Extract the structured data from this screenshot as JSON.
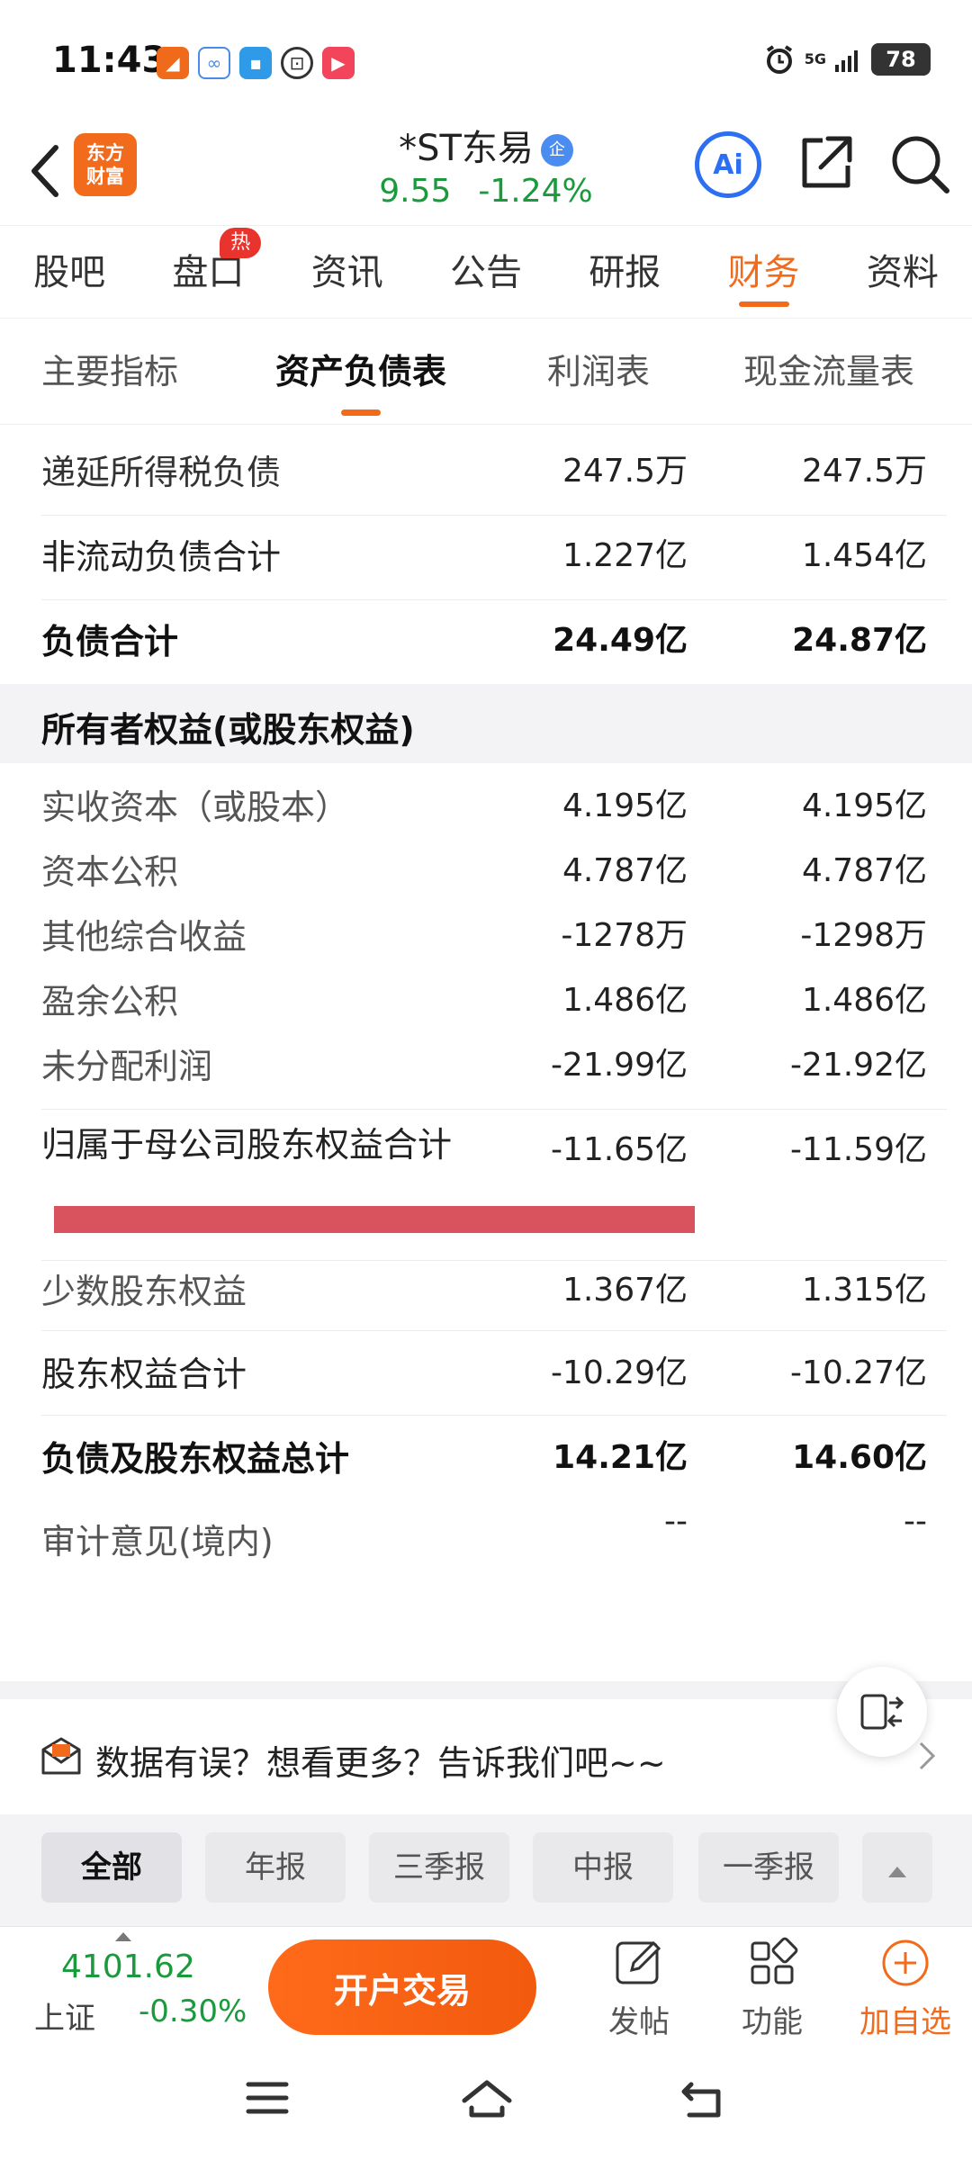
{
  "status_bar": {
    "time": "11:43",
    "network": "5G",
    "battery": "78",
    "icons": [
      "alarm-icon",
      "signal-icon"
    ]
  },
  "header": {
    "brand_logo": "东方\n财富",
    "stock_name": "*ST东易",
    "verified_badge": "企",
    "price": "9.55",
    "change_pct": "-1.24%",
    "ai_label": "Ai",
    "price_color": "#1a9a3c"
  },
  "main_tabs": [
    {
      "label": "股吧"
    },
    {
      "label": "盘口",
      "badge": "热"
    },
    {
      "label": "资讯"
    },
    {
      "label": "公告"
    },
    {
      "label": "研报"
    },
    {
      "label": "财务",
      "active": true
    },
    {
      "label": "资料"
    }
  ],
  "sub_tabs": [
    {
      "label": "主要指标"
    },
    {
      "label": "资产负债表",
      "active": true
    },
    {
      "label": "利润表"
    },
    {
      "label": "现金流量表"
    }
  ],
  "table": {
    "rows": [
      {
        "label": "递延所得税负债",
        "v1": "247.5万",
        "v2": "247.5万"
      },
      {
        "label": "非流动负债合计",
        "v1": "1.227亿",
        "v2": "1.454亿"
      },
      {
        "label": "负债合计",
        "v1": "24.49亿",
        "v2": "24.87亿"
      }
    ],
    "section_header": "所有者权益(或股东权益)",
    "equity_rows": [
      {
        "label": "实收资本（或股本）",
        "v1": "4.195亿",
        "v2": "4.195亿"
      },
      {
        "label": "资本公积",
        "v1": "4.787亿",
        "v2": "4.787亿"
      },
      {
        "label": "其他综合收益",
        "v1": "-1278万",
        "v2": "-1298万"
      },
      {
        "label": "盈余公积",
        "v1": "1.486亿",
        "v2": "1.486亿"
      },
      {
        "label": "未分配利润",
        "v1": "-21.99亿",
        "v2": "-21.92亿"
      }
    ],
    "parent_equity": {
      "label": "归属于母公司股东权益合计",
      "v1": "-11.65亿",
      "v2": "-11.59亿"
    },
    "tail_rows": [
      {
        "label": "少数股东权益",
        "v1": "1.367亿",
        "v2": "1.315亿"
      },
      {
        "label": "股东权益合计",
        "v1": "-10.29亿",
        "v2": "-10.27亿"
      },
      {
        "label": "负债及股东权益总计",
        "v1": "14.21亿",
        "v2": "14.60亿"
      },
      {
        "label": "审计意见(境内)",
        "v1": "--",
        "v2": "--"
      }
    ],
    "highlight_color": "#d9535f"
  },
  "feedback": {
    "text": "数据有误？想看更多？告诉我们吧~~"
  },
  "filters": [
    {
      "label": "全部",
      "active": true
    },
    {
      "label": "年报"
    },
    {
      "label": "三季报"
    },
    {
      "label": "中报"
    },
    {
      "label": "一季报"
    }
  ],
  "bottom_bar": {
    "index_value": "4101.62",
    "index_name": "上证",
    "index_change": "-0.30%",
    "trade_button": "开户交易",
    "tools": [
      {
        "label": "发帖",
        "icon": "edit-icon"
      },
      {
        "label": "功能",
        "icon": "grid-icon"
      },
      {
        "label": "加自选",
        "icon": "add-circle-icon"
      }
    ],
    "accent_color": "#f26b1d"
  }
}
